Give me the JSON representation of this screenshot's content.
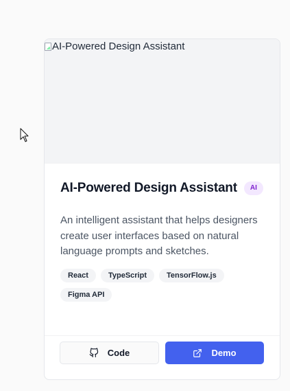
{
  "project": {
    "image_alt": "AI-Powered Design Assistant",
    "title": "AI-Powered Design Assistant",
    "badge": "AI",
    "description": "An intelligent assistant that helps designers create user interfaces based on natural language prompts and sketches.",
    "tags": [
      "React",
      "TypeScript",
      "TensorFlow.js",
      "Figma API"
    ]
  },
  "actions": {
    "code_label": "Code",
    "code_icon": "github-icon",
    "demo_label": "Demo",
    "demo_icon": "external-link-icon"
  },
  "colors": {
    "accent": "#4361ee",
    "badge_text": "#7e22ce",
    "badge_bg": "#f3e8ff"
  }
}
